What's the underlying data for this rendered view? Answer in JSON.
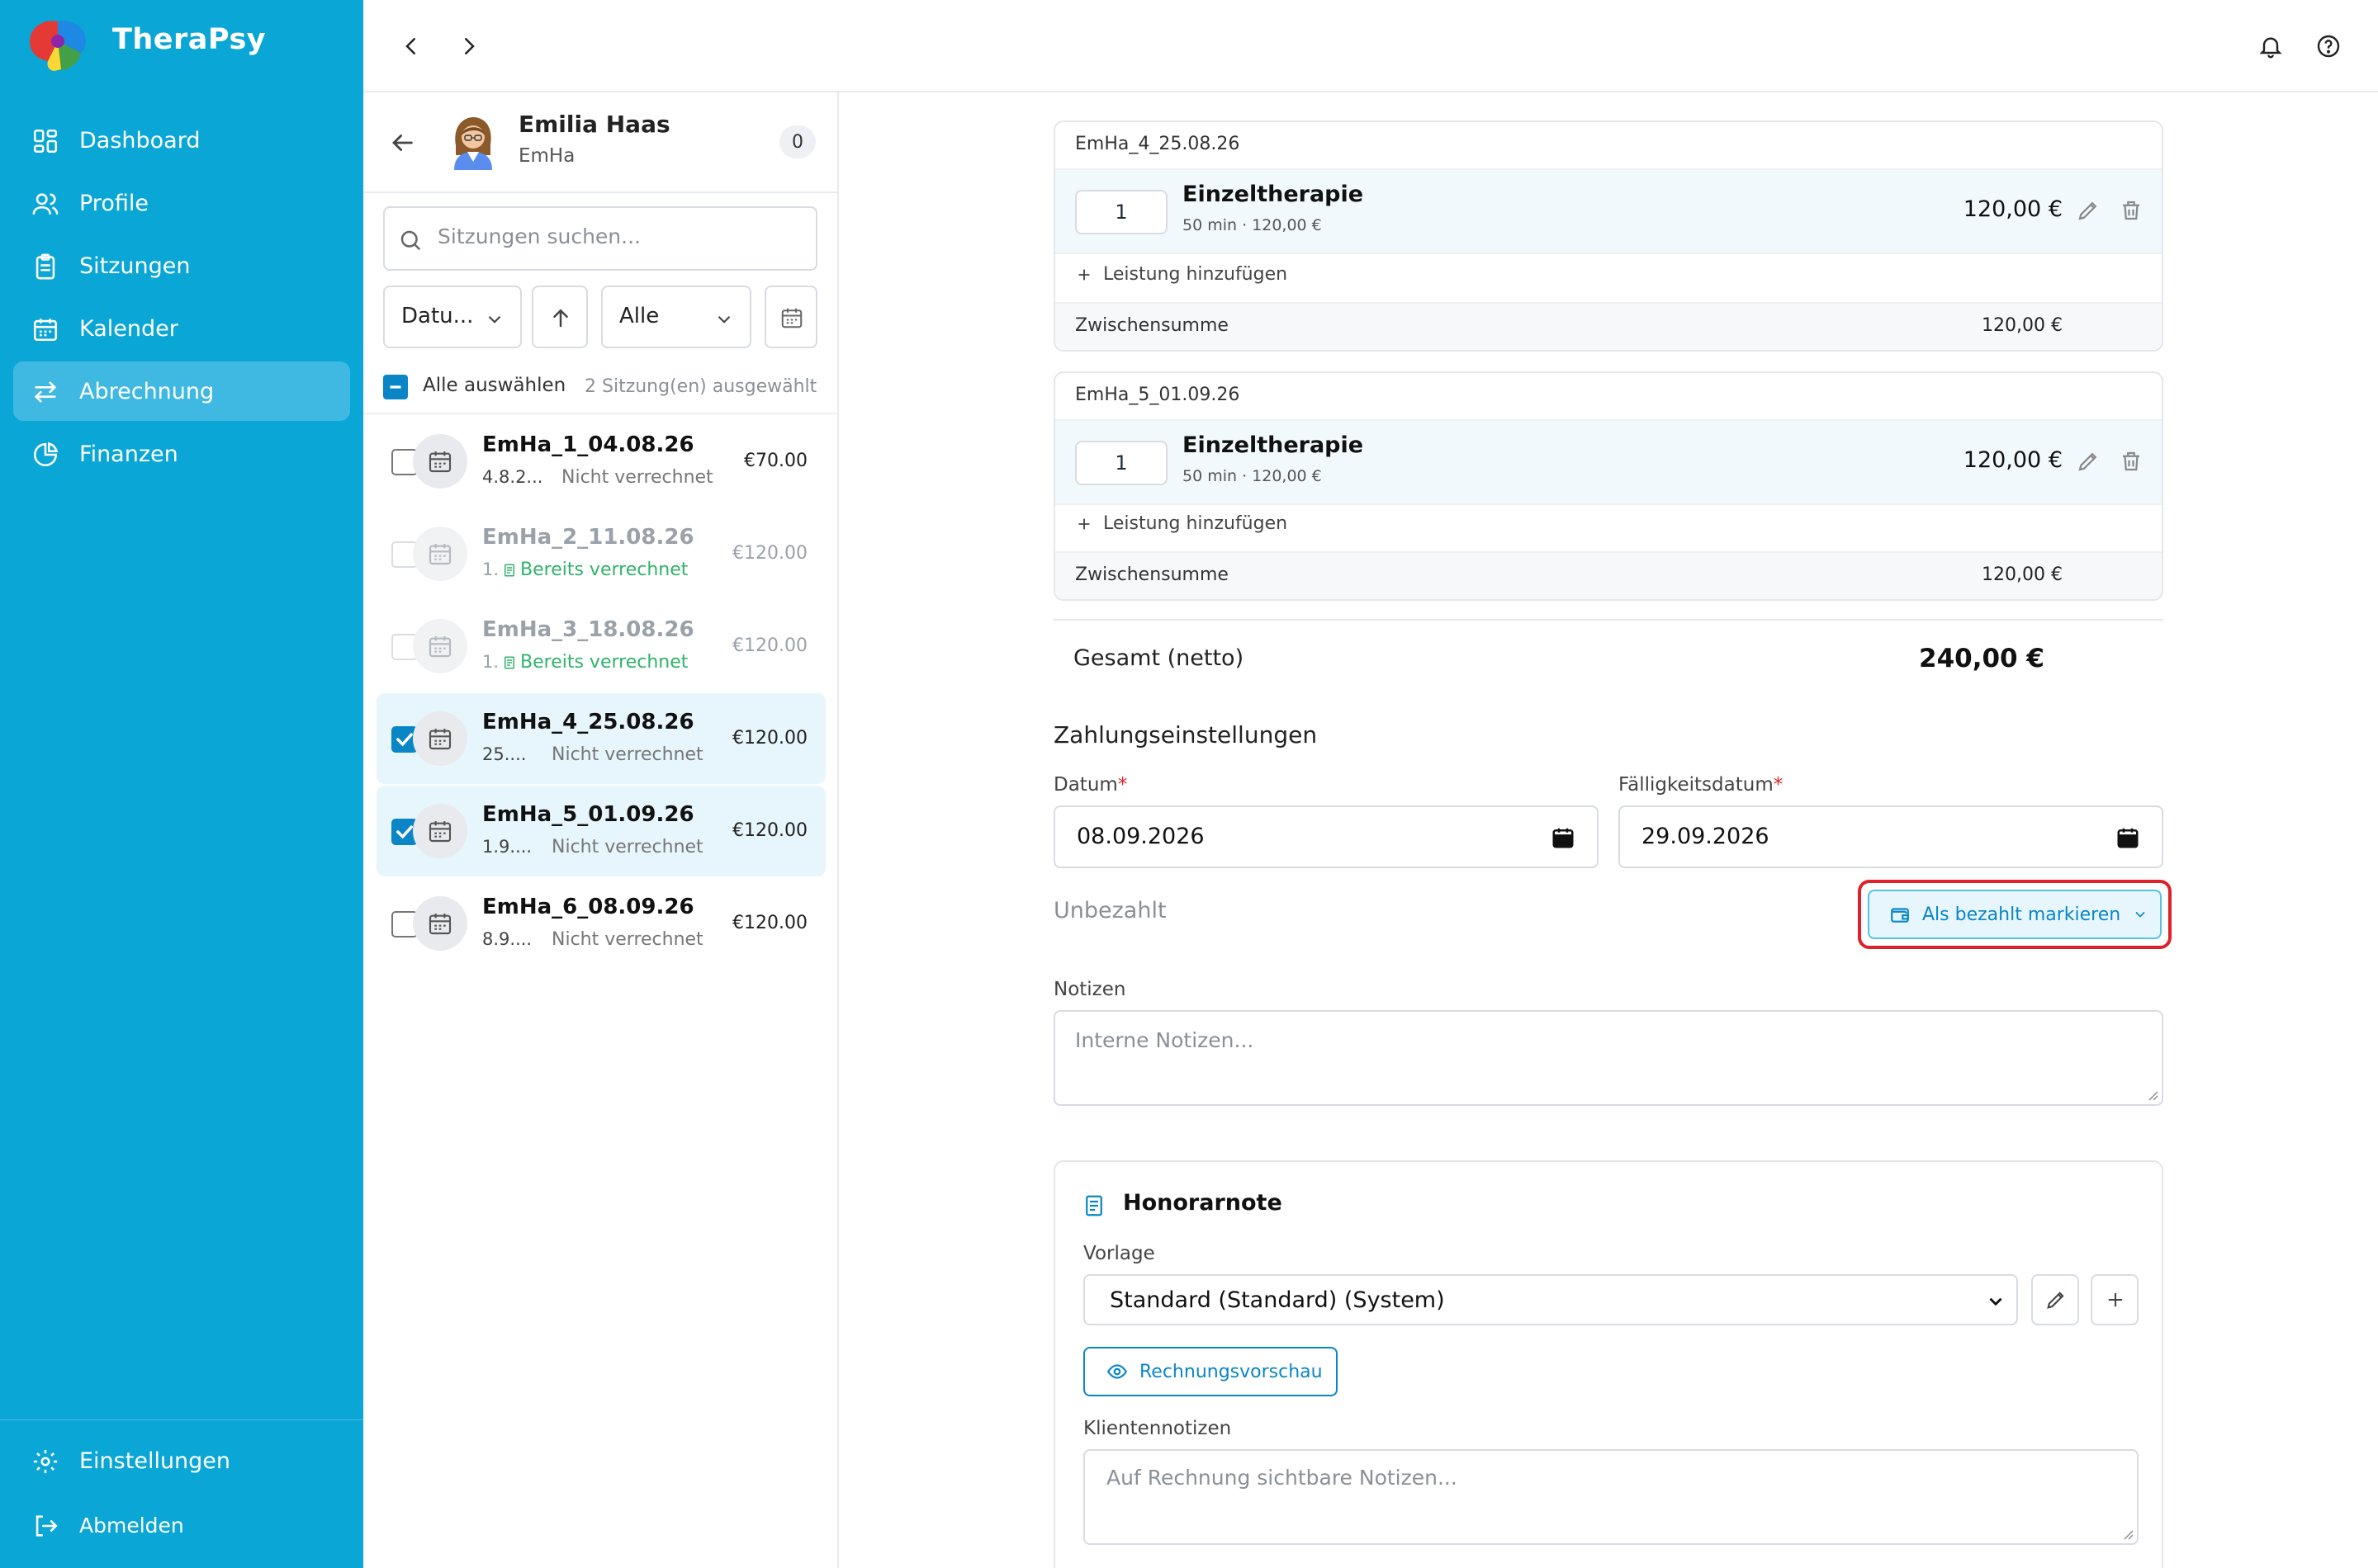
{
  "app": {
    "name": "TheraPsy"
  },
  "colors": {
    "brand": "#0aa6d6",
    "accent": "#0a86c6",
    "paid_green": "#2fb36a",
    "highlight": "#e0202a"
  },
  "sidebar": {
    "items": [
      {
        "label": "Dashboard",
        "icon": "dashboard-icon"
      },
      {
        "label": "Profile",
        "icon": "users-icon"
      },
      {
        "label": "Sitzungen",
        "icon": "clipboard-icon"
      },
      {
        "label": "Kalender",
        "icon": "calendar-icon"
      },
      {
        "label": "Abrechnung",
        "icon": "exchange-icon",
        "active": true
      },
      {
        "label": "Finanzen",
        "icon": "pie-chart-icon"
      }
    ],
    "settings_label": "Einstellungen",
    "logout_label": "Abmelden"
  },
  "client": {
    "name": "Emilia Haas",
    "code": "EmHa",
    "count": "0"
  },
  "search": {
    "placeholder": "Sitzungen suchen..."
  },
  "filters": {
    "sort_label": "Datu...",
    "status_label": "Alle"
  },
  "select_all": {
    "label": "Alle auswählen",
    "count_text": "2 Sitzung(en) ausgewählt"
  },
  "sessions": [
    {
      "name": "EmHa_1_04.08.26",
      "date": "4.8.2...",
      "status": "Nicht verrechnet",
      "amount": "€70.00",
      "state": "unchecked"
    },
    {
      "name": "EmHa_2_11.08.26",
      "date": "1.",
      "status": "Bereits verrechnet",
      "amount": "€120.00",
      "state": "disabled"
    },
    {
      "name": "EmHa_3_18.08.26",
      "date": "1.",
      "status": "Bereits verrechnet",
      "amount": "€120.00",
      "state": "disabled"
    },
    {
      "name": "EmHa_4_25.08.26",
      "date": "25....",
      "status": "Nicht verrechnet",
      "amount": "€120.00",
      "state": "checked"
    },
    {
      "name": "EmHa_5_01.09.26",
      "date": "1.9....",
      "status": "Nicht verrechnet",
      "amount": "€120.00",
      "state": "checked"
    },
    {
      "name": "EmHa_6_08.09.26",
      "date": "8.9....",
      "status": "Nicht verrechnet",
      "amount": "€120.00",
      "state": "unchecked"
    }
  ],
  "invoice_groups": [
    {
      "title": "EmHa_4_25.08.26",
      "qty": "1",
      "service": "Einzeltherapie",
      "meta": "50 min · 120,00 €",
      "price": "120,00 €",
      "add_label": "Leistung hinzufügen",
      "subtotal_label": "Zwischensumme",
      "subtotal": "120,00 €"
    },
    {
      "title": "EmHa_5_01.09.26",
      "qty": "1",
      "service": "Einzeltherapie",
      "meta": "50 min · 120,00 €",
      "price": "120,00 €",
      "add_label": "Leistung hinzufügen",
      "subtotal_label": "Zwischensumme",
      "subtotal": "120,00 €"
    }
  ],
  "total": {
    "label": "Gesamt (netto)",
    "value": "240,00 €"
  },
  "payment": {
    "heading": "Zahlungseinstellungen",
    "date_label": "Datum",
    "date_value": "08.09.2026",
    "due_label": "Fälligkeitsdatum",
    "due_value": "29.09.2026",
    "status": "Unbezahlt",
    "mark_paid_label": "Als bezahlt markieren"
  },
  "notes": {
    "label": "Notizen",
    "placeholder": "Interne Notizen..."
  },
  "honorarnote": {
    "title": "Honorarnote",
    "template_label": "Vorlage",
    "template_value": "Standard (Standard) (System)",
    "preview_label": "Rechnungsvorschau",
    "client_notes_label": "Klientennotizen",
    "client_notes_placeholder": "Auf Rechnung sichtbare Notizen..."
  }
}
